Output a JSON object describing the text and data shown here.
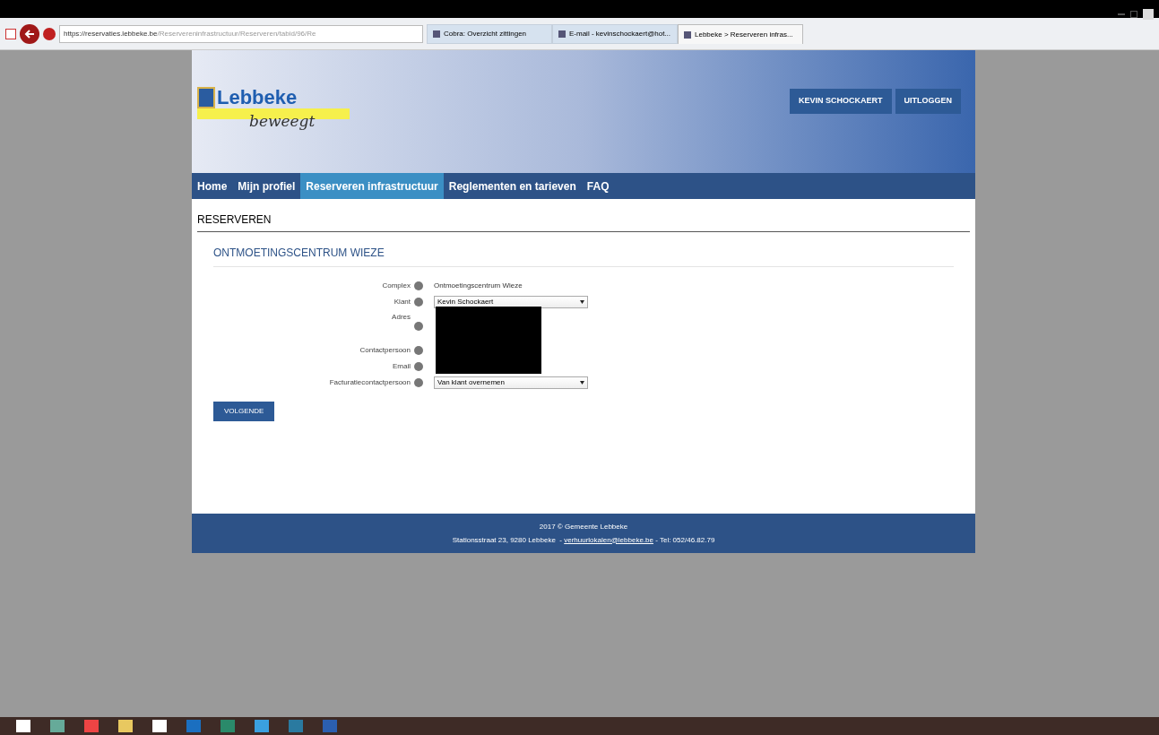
{
  "browser": {
    "url_host": "https://reservaties.lebbeke.be",
    "url_path": "/Reservereninfrastructuur/Reserveren/tabid/96/Re",
    "tabs": [
      {
        "title": "Cobra: Overzicht zittingen",
        "selected": false
      },
      {
        "title": "E-mail - kevinschockaert@hot...",
        "selected": false
      },
      {
        "title": "Lebbeke > Reserveren infras...",
        "selected": true
      }
    ]
  },
  "header": {
    "logo_title": "Lebbeke",
    "logo_subtitle": "beweegt",
    "user_button": "KEVIN SCHOCKAERT",
    "logout_button": "UITLOGGEN"
  },
  "nav": [
    {
      "label": "Home",
      "selected": false
    },
    {
      "label": "Mijn profiel",
      "selected": false
    },
    {
      "label": "Reserveren infrastructuur",
      "selected": true
    },
    {
      "label": "Reglementen en tarieven",
      "selected": false
    },
    {
      "label": "FAQ",
      "selected": false
    }
  ],
  "page_title": "RESERVEREN",
  "section_title": "ONTMOETINGSCENTRUM WIEZE",
  "form": [
    {
      "label": "Complex",
      "kind": "text",
      "value": "Ontmoetingscentrum Wieze"
    },
    {
      "label": "Klant",
      "kind": "select",
      "value": "Kevin Schockaert"
    },
    {
      "label": "Adres",
      "kind": "redacted"
    },
    {
      "label": "Contactpersoon",
      "kind": "redacted"
    },
    {
      "label": "Email",
      "kind": "redacted"
    },
    {
      "label": "Facturatiecontactpersoon",
      "kind": "select",
      "value": "Van klant overnemen"
    }
  ],
  "next_button": "VOLGENDE",
  "footer": {
    "line1": "2017 © Gemeente Lebbeke",
    "address": "Stationsstraat 23, 9280 Lebbeke  -",
    "email": "verhuurlokalen@lebbeke.be",
    "phone": "- Tel: 052/46.82.79"
  }
}
